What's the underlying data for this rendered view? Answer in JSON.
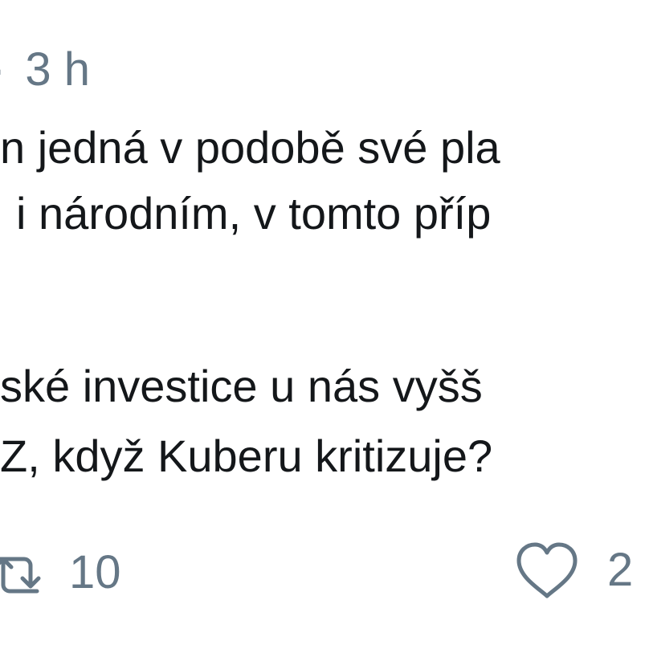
{
  "tweet": {
    "meta": {
      "separator": "·",
      "time": "3 h"
    },
    "lines": [
      "n jedná  v podobě své pla",
      "i národním, v tomto příp",
      "ské investice u nás vyšš",
      "Z, když Kuberu kritizuje?"
    ]
  },
  "actions": {
    "retweet": {
      "icon": "retweet-icon",
      "count": "10"
    },
    "like": {
      "icon": "heart-icon",
      "count": "2"
    }
  },
  "colors": {
    "text": "#14171a",
    "muted": "#657786",
    "background": "#ffffff"
  }
}
